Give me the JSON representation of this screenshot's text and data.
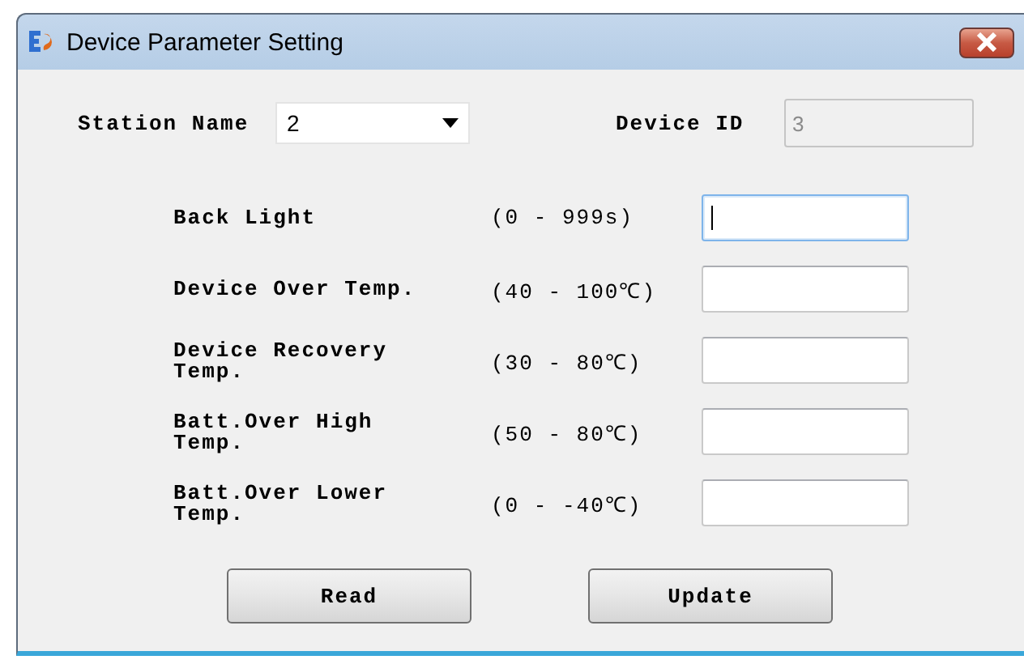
{
  "window": {
    "title": "Device Parameter Setting"
  },
  "station": {
    "label": "Station Name",
    "value": "2"
  },
  "device_id": {
    "label": "Device ID",
    "value": "3",
    "disabled": true
  },
  "params": [
    {
      "label": "Back Light",
      "range": "(0 - 999s)",
      "focused": true
    },
    {
      "label": "Device Over Temp.",
      "range": "(40 - 100℃)",
      "focused": false
    },
    {
      "label": "Device Recovery Temp.",
      "range": "(30 - 80℃)",
      "focused": false
    },
    {
      "label": "Batt.Over High Temp.",
      "range": "(50 - 80℃)",
      "focused": false
    },
    {
      "label": "Batt.Over Lower Temp.",
      "range": "(0 - -40℃)",
      "focused": false
    }
  ],
  "buttons": [
    "Read",
    "Update"
  ]
}
